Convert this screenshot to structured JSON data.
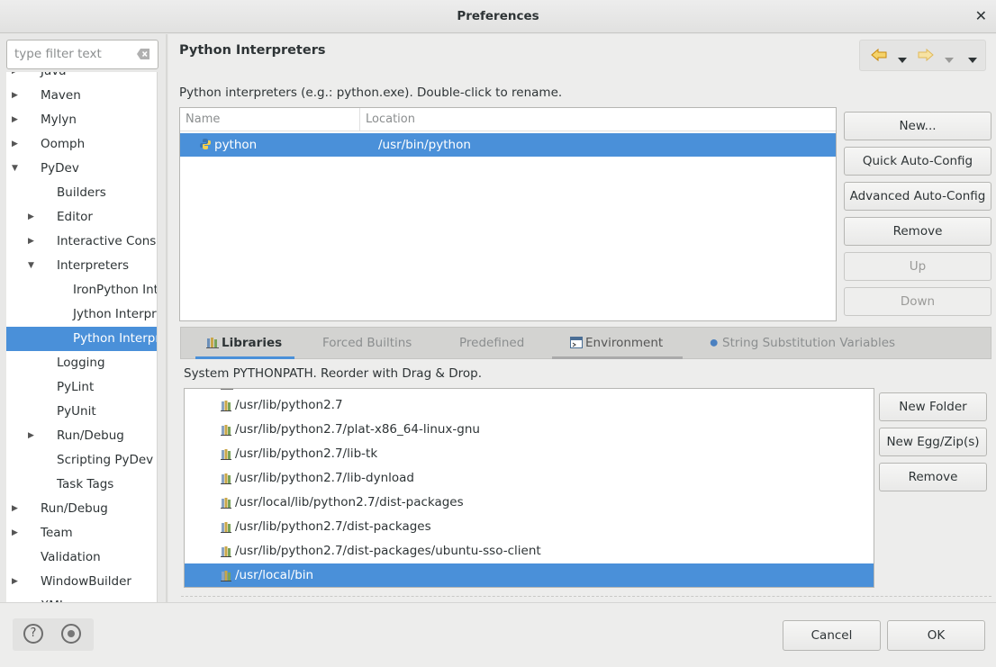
{
  "window": {
    "title": "Preferences",
    "close_glyph": "✕"
  },
  "filter": {
    "placeholder": "type filter text",
    "value": ""
  },
  "tree": {
    "items": [
      {
        "label": "Java",
        "indent": 0,
        "arrow": "right",
        "partial": true
      },
      {
        "label": "Maven",
        "indent": 0,
        "arrow": "right"
      },
      {
        "label": "Mylyn",
        "indent": 0,
        "arrow": "right"
      },
      {
        "label": "Oomph",
        "indent": 0,
        "arrow": "right"
      },
      {
        "label": "PyDev",
        "indent": 0,
        "arrow": "down"
      },
      {
        "label": "Builders",
        "indent": 1,
        "arrow": ""
      },
      {
        "label": "Editor",
        "indent": 1,
        "arrow": "right"
      },
      {
        "label": "Interactive Console",
        "indent": 1,
        "arrow": "right"
      },
      {
        "label": "Interpreters",
        "indent": 1,
        "arrow": "down"
      },
      {
        "label": "IronPython Interpreter",
        "indent": 2,
        "arrow": ""
      },
      {
        "label": "Jython Interpreter",
        "indent": 2,
        "arrow": ""
      },
      {
        "label": "Python Interpreter",
        "indent": 2,
        "arrow": "",
        "selected": true
      },
      {
        "label": "Logging",
        "indent": 1,
        "arrow": ""
      },
      {
        "label": "PyLint",
        "indent": 1,
        "arrow": ""
      },
      {
        "label": "PyUnit",
        "indent": 1,
        "arrow": ""
      },
      {
        "label": "Run/Debug",
        "indent": 1,
        "arrow": "right"
      },
      {
        "label": "Scripting PyDev",
        "indent": 1,
        "arrow": ""
      },
      {
        "label": "Task Tags",
        "indent": 1,
        "arrow": ""
      },
      {
        "label": "Run/Debug",
        "indent": 0,
        "arrow": "right"
      },
      {
        "label": "Team",
        "indent": 0,
        "arrow": "right"
      },
      {
        "label": "Validation",
        "indent": 0,
        "arrow": ""
      },
      {
        "label": "WindowBuilder",
        "indent": 0,
        "arrow": "right"
      },
      {
        "label": "XML",
        "indent": 0,
        "arrow": "right",
        "partial": true
      }
    ]
  },
  "page": {
    "title": "Python Interpreters",
    "description": "Python interpreters (e.g.: python.exe).   Double-click to rename."
  },
  "interpreters": {
    "columns": [
      "Name",
      "Location"
    ],
    "rows": [
      {
        "name": "python",
        "location": "/usr/bin/python"
      }
    ]
  },
  "interpreter_buttons": {
    "new": "New...",
    "quick": "Quick Auto-Config",
    "advanced": "Advanced Auto-Config",
    "remove": "Remove",
    "up": "Up",
    "down": "Down"
  },
  "tabs": {
    "libraries": "Libraries",
    "forced": "Forced Builtins",
    "predefined": "Predefined",
    "environment": "Environment",
    "string_subst": "String Substitution Variables"
  },
  "pythonpath": {
    "description": "System PYTHONPATH.   Reorder with Drag & Drop.",
    "paths": [
      "/usr/lib/python2.7",
      "/usr/lib/python2.7/plat-x86_64-linux-gnu",
      "/usr/lib/python2.7/lib-tk",
      "/usr/lib/python2.7/lib-dynload",
      "/usr/local/lib/python2.7/dist-packages",
      "/usr/lib/python2.7/dist-packages",
      "/usr/lib/python2.7/dist-packages/ubuntu-sso-client",
      "/usr/local/bin"
    ],
    "selected_index": 7
  },
  "path_buttons": {
    "new_folder": "New Folder",
    "new_egg": "New Egg/Zip(s)",
    "remove": "Remove"
  },
  "footer": {
    "help_glyph": "?",
    "cancel": "Cancel",
    "ok": "OK"
  },
  "colors": {
    "selection": "#4a90d9",
    "nav_arrow": "#e8a215"
  }
}
